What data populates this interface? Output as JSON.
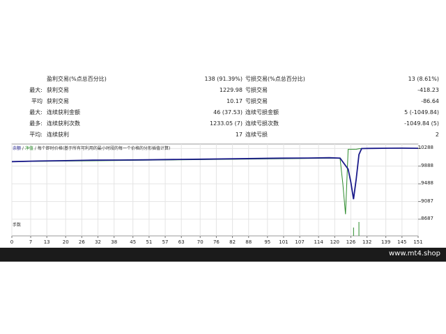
{
  "stats": {
    "rows": [
      {
        "prefix": "",
        "label1": "盈利交易(%点总百分比)",
        "value1": "138 (91.39%)",
        "label2": "亏损交易(%点总百分比)",
        "value2": "13 (8.61%)"
      },
      {
        "prefix": "最大:",
        "label1": "获利交易",
        "value1": "1229.98",
        "label2": "亏损交易",
        "value2": "-418.23"
      },
      {
        "prefix": "平均",
        "label1": "获利交易",
        "value1": "10.17",
        "label2": "亏损交易",
        "value2": "-86.64"
      },
      {
        "prefix": "最大:",
        "label1": "连续获利金额",
        "value1": "46 (37.53)",
        "label2": "连续亏损金额",
        "value2": "5 (-1049.84)"
      },
      {
        "prefix": "最多:",
        "label1": "连续获利次数",
        "value1": "1233.05 (7)",
        "label2": "连续亏损次数",
        "value2": "-1049.84 (5)"
      },
      {
        "prefix": "平均:",
        "label1": "连续获利",
        "value1": "17",
        "label2": "连续亏损",
        "value2": "2"
      }
    ]
  },
  "chart": {
    "legend_balance": "余额",
    "legend_sep1": " / ",
    "legend_equity": "净值",
    "legend_sep2": " / ",
    "legend_desc": "每个即时价格(基于所有可利用的最小时段的每一个价格的分形插值计算)",
    "volume_label": "手数",
    "colors": {
      "balance": "#1a1a8a",
      "equity": "#2a8a2a",
      "grid": "#e4e4e4"
    }
  },
  "chart_data": {
    "type": "line",
    "y_ticks": [
      "10288",
      "9888",
      "9488",
      "9087",
      "8687"
    ],
    "x_ticks": [
      "0",
      "7",
      "13",
      "20",
      "26",
      "32",
      "38",
      "45",
      "51",
      "57",
      "63",
      "70",
      "76",
      "82",
      "88",
      "95",
      "101",
      "107",
      "114",
      "120",
      "126",
      "132",
      "139",
      "145",
      "151"
    ],
    "xlim": [
      0,
      151
    ],
    "ylim": [
      8687,
      10388
    ],
    "series": [
      {
        "name": "余额",
        "x": [
          0,
          10,
          20,
          30,
          40,
          50,
          60,
          70,
          80,
          90,
          100,
          110,
          118,
          122,
          125,
          126,
          127,
          128,
          129,
          130,
          132,
          135,
          140,
          145,
          151
        ],
        "y": [
          9990,
          10003,
          10012,
          10022,
          10025,
          10030,
          10038,
          10045,
          10052,
          10060,
          10068,
          10072,
          10078,
          10070,
          9820,
          9520,
          9140,
          9600,
          10150,
          10285,
          10288,
          10290,
          10293,
          10295,
          10292
        ]
      },
      {
        "name": "净值",
        "x": [
          0,
          120,
          122,
          123,
          124,
          125,
          127,
          128,
          129,
          130,
          132,
          140,
          151
        ],
        "y": [
          9990,
          10068,
          10060,
          9500,
          8800,
          10268,
          10268,
          10270,
          10282,
          10285,
          10288,
          10293,
          10292
        ]
      }
    ],
    "volume": {
      "x": [
        127,
        129
      ],
      "y": [
        0.6,
        1.0
      ]
    }
  },
  "footer": {
    "watermark": "www.mt4.shop"
  }
}
